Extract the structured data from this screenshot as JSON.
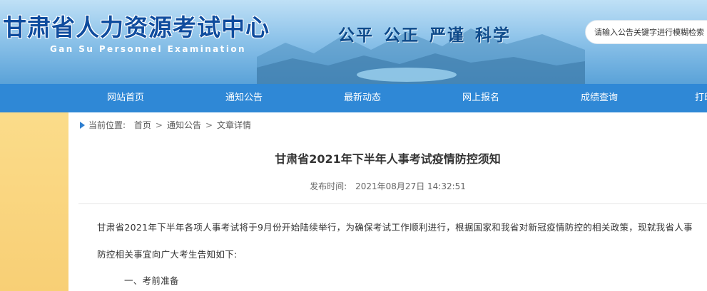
{
  "header": {
    "title": "甘肃省人力资源考试中心",
    "subtitle": "Gan Su Personnel Examination",
    "slogan": "公平 公正 严谨 科学",
    "search_placeholder": "请输入公告关键字进行模糊检索"
  },
  "nav": {
    "items": [
      {
        "label": "网站首页"
      },
      {
        "label": "通知公告"
      },
      {
        "label": "最新动态"
      },
      {
        "label": "网上报名"
      },
      {
        "label": "成绩查询"
      },
      {
        "label": "打印"
      }
    ]
  },
  "breadcrumb": {
    "prefix": "当前位置:",
    "items": [
      "首页",
      "通知公告",
      "文章详情"
    ],
    "separator": ">"
  },
  "article": {
    "title": "甘肃省2021年下半年人事考试疫情防控须知",
    "published_label": "发布时间:",
    "published_value": "2021年08月27日 14:32:51",
    "paragraphs": [
      "甘肃省2021年下半年各项人事考试将于9月份开始陆续举行，为确保考试工作顺利进行，根据国家和我省对新冠疫情防控的相关政策，现就我省人事",
      "防控相关事宜向广大考生告知如下:",
      "一、考前准备"
    ]
  },
  "colors": {
    "nav_bg": "#2f88d6",
    "title_blue": "#0f4c9e",
    "sidebar_yellow": "#f8cf75"
  }
}
